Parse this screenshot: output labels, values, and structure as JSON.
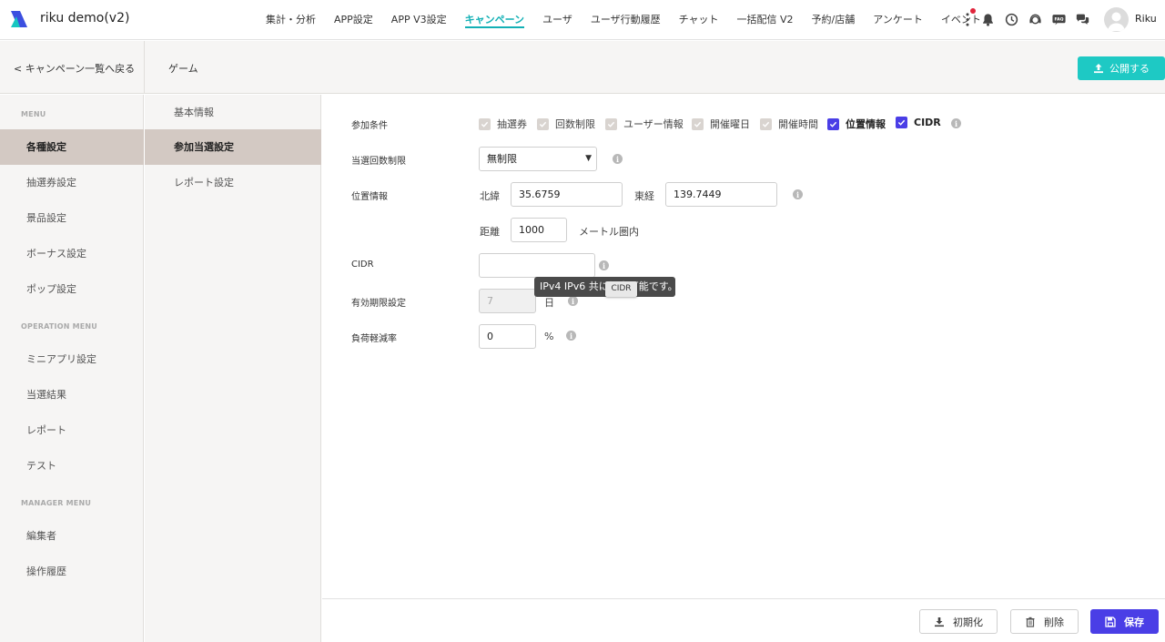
{
  "header": {
    "app_title": "riku demo(v2)",
    "nav": [
      "集計・分析",
      "APP設定",
      "APP V3設定",
      "キャンペーン",
      "ユーザ",
      "ユーザ行動履歴",
      "チャット",
      "一括配信 V2",
      "予約/店舗",
      "アンケート",
      "イベント"
    ],
    "active_nav": "キャンペーン",
    "faq_icon_label": "FAQ",
    "user_name": "Riku",
    "accent_color": "#12b0b5",
    "notification_dot_color": "#e0243b"
  },
  "subheader": {
    "back_label": "< キャンペーン一覧へ戻る",
    "game_label": "ゲーム",
    "publish_label": "公開する",
    "publish_color": "#1ec9c4"
  },
  "sidebar": {
    "menu_title": "MENU",
    "menu_items": [
      "各種設定",
      "抽選券設定",
      "景品設定",
      "ボーナス設定",
      "ポップ設定"
    ],
    "operation_title": "OPERATION MENU",
    "operation_items": [
      "ミニアプリ設定",
      "当選結果",
      "レポート",
      "テスト"
    ],
    "manager_title": "MANAGER MENU",
    "manager_items": [
      "編集者",
      "操作履歴"
    ],
    "active_item": "各種設定"
  },
  "sidebar2": {
    "items": [
      "基本情報",
      "参加当選設定",
      "レポート設定"
    ],
    "active_item": "参加当選設定"
  },
  "form": {
    "conditions_label": "参加条件",
    "conditions": [
      {
        "label": "抽選券",
        "checked": true,
        "disabled": true
      },
      {
        "label": "回数制限",
        "checked": true,
        "disabled": true
      },
      {
        "label": "ユーザー情報",
        "checked": true,
        "disabled": true
      },
      {
        "label": "開催曜日",
        "checked": true,
        "disabled": true
      },
      {
        "label": "開催時間",
        "checked": true,
        "disabled": true
      },
      {
        "label": "位置情報",
        "checked": true,
        "disabled": false
      },
      {
        "label": "CIDR",
        "checked": true,
        "disabled": false
      }
    ],
    "win_limit_label": "当選回数制限",
    "win_limit_value": "無制限",
    "location_label": "位置情報",
    "lat_label": "北緯",
    "lat_value": "35.6759",
    "lng_label": "東経",
    "lng_value": "139.7449",
    "distance_label": "距離",
    "distance_value": "1000",
    "distance_unit": "メートル圏内",
    "cidr_label": "CIDR",
    "cidr_value": "",
    "tooltip_text": "IPv4 IPv6 共に設定可能です。",
    "mini_tooltip": "CIDR",
    "expiry_label": "有効期限設定",
    "expiry_value": "7",
    "expiry_unit": "日",
    "load_label": "負荷軽減率",
    "load_value": "0",
    "load_unit": "%",
    "checkbox_color": "#4a3ee6"
  },
  "footer": {
    "reset_label": "初期化",
    "delete_label": "削除",
    "save_label": "保存"
  }
}
